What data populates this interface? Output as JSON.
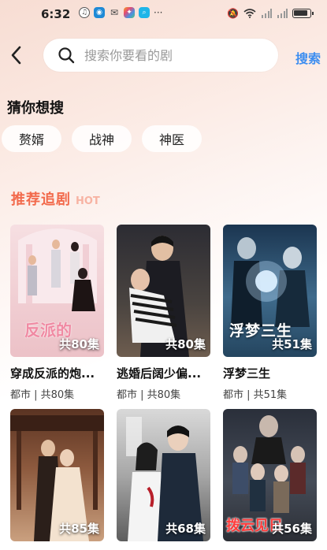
{
  "status_bar": {
    "time": "6:32",
    "left_icons": [
      "cloud-music-icon",
      "teal-app-icon",
      "wechat-icon",
      "colorful-app-icon",
      "search-app-icon"
    ],
    "more": "···",
    "right_icons": [
      "mute-icon",
      "wifi-icon",
      "signal-icon",
      "signal-icon",
      "battery-icon"
    ]
  },
  "header": {
    "search_placeholder": "搜索你要看的剧",
    "search_button": "搜索"
  },
  "guess": {
    "title": "猜你想搜",
    "chips": [
      "赘婿",
      "战神",
      "神医"
    ]
  },
  "recommend": {
    "title": "推荐追剧",
    "hot": "HOT",
    "cards": [
      {
        "title": "穿成反派的炮...",
        "meta": "都市 | 共80集",
        "count": "共80集",
        "poster_text": "反派的",
        "colors": [
          "#f4d7d9",
          "#e8b6bd"
        ]
      },
      {
        "title": "逃婚后阔少偏...",
        "meta": "都市 | 共80集",
        "count": "共80集",
        "poster_text": "",
        "colors": [
          "#3a3a40",
          "#6b5a4e"
        ]
      },
      {
        "title": "浮梦三生",
        "meta": "都市 | 共51集",
        "count": "共51集",
        "poster_text": "浮梦三生",
        "colors": [
          "#1d3a55",
          "#4f7a9a"
        ]
      },
      {
        "title": "",
        "meta": "",
        "count": "共85集",
        "poster_text": "",
        "colors": [
          "#7a4a35",
          "#c9a48a"
        ]
      },
      {
        "title": "",
        "meta": "",
        "count": "共68集",
        "poster_text": "",
        "colors": [
          "#8c8c8c",
          "#d9d9d9"
        ]
      },
      {
        "title": "",
        "meta": "",
        "count": "共56集",
        "poster_text": "拨云见日",
        "colors": [
          "#2a2f3a",
          "#5a6370"
        ]
      }
    ]
  }
}
